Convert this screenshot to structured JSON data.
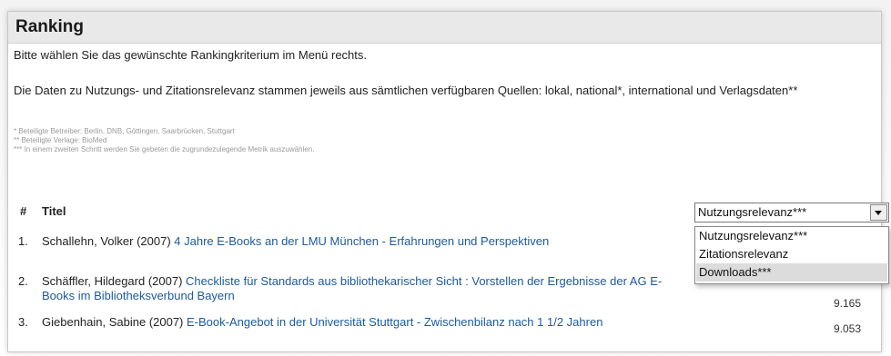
{
  "panel": {
    "title": "Ranking"
  },
  "intro": "Bitte wählen Sie das gewünschte Rankingkriterium im Menü rechts.",
  "paragraph": "Die Daten zu Nutzungs- und Zitationsrelevanz stammen jeweils aus sämtlichen verfügbaren Quellen: lokal, national*, international und Verlagsdaten**",
  "footnotes": [
    "* Beteiligte Betreiber: Berlin, DNB, Göttingen, Saarbrücken, Stuttgart",
    "** Beteiligte Verlage: BioMed",
    "*** In einem zweiten Schritt werden Sie gebeten die zugrundezulegende Metrik auszuwählen."
  ],
  "table": {
    "col_hash": "#",
    "col_title": "Titel"
  },
  "select": {
    "value": "Nutzungsrelevanz***",
    "options": [
      "Nutzungsrelevanz***",
      "Zitationsrelevanz",
      "Downloads***"
    ],
    "highlighted_index": 2
  },
  "rows": [
    {
      "num": "1.",
      "author": "Schallehn, Volker (2007)",
      "title": "4 Jahre E-Books an der LMU München - Erfahrungen und Perspektiven",
      "score": ""
    },
    {
      "num": "2.",
      "author": "Schäffler, Hildegard (2007)",
      "title": "Checkliste für Standards aus bibliothekarischer Sicht : Vorstellen der Ergebnisse der AG E-Books im Bibliotheksverbund Bayern",
      "score": "9.165"
    },
    {
      "num": "3.",
      "author": "Giebenhain, Sabine (2007)",
      "title": "E-Book-Angebot in der Universität Stuttgart - Zwischenbilanz nach 1 1/2 Jahren",
      "score": "9.053"
    }
  ],
  "colors": {
    "link": "#1b5a9c",
    "header_bg": "#e9e9e9"
  }
}
